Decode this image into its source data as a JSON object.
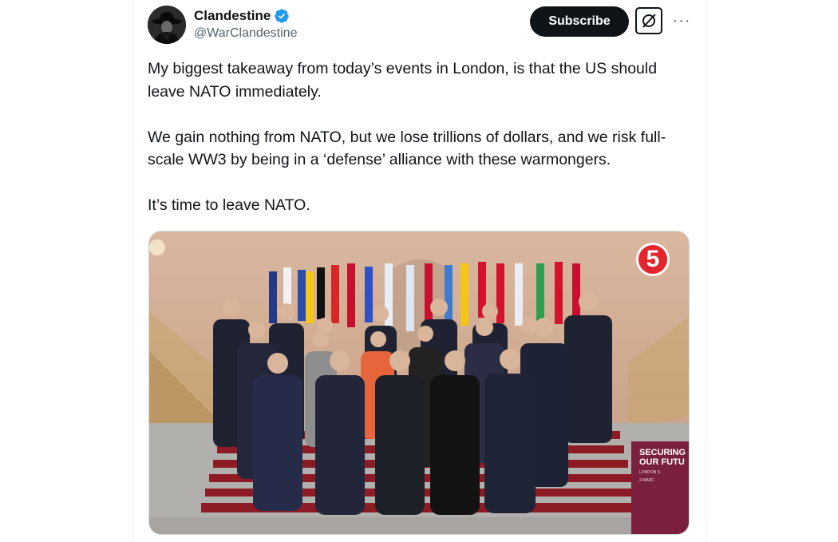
{
  "post": {
    "author": {
      "name": "Clandestine",
      "handle": "@WarClandestine",
      "verified_icon": "verified-badge-icon"
    },
    "actions": {
      "subscribe_label": "Subscribe",
      "grok_icon": "grok-icon",
      "more_icon": "more-options-icon",
      "more_glyph": "···"
    },
    "text": {
      "paragraph1": "My biggest takeaway from today’s events in London, is that the US should leave NATO immediately.",
      "paragraph2": "We gain nothing from NATO, but we lose trillions of dollars, and we risk full-scale WW3 by being in a ‘defense’ alliance with these warmongers.",
      "paragraph3": "It’s time to leave NATO."
    },
    "media": {
      "channel_badge": "5",
      "banner_line1": "SECURING",
      "banner_line2": "OUR FUTU",
      "banner_small1": "LONDON S",
      "banner_small2": "2 MARC"
    }
  },
  "colors": {
    "verified": "#1d9bf0",
    "text_primary": "#0f1419",
    "text_secondary": "#536471",
    "badge": "#e3262c",
    "banner": "#7a1f3d"
  }
}
